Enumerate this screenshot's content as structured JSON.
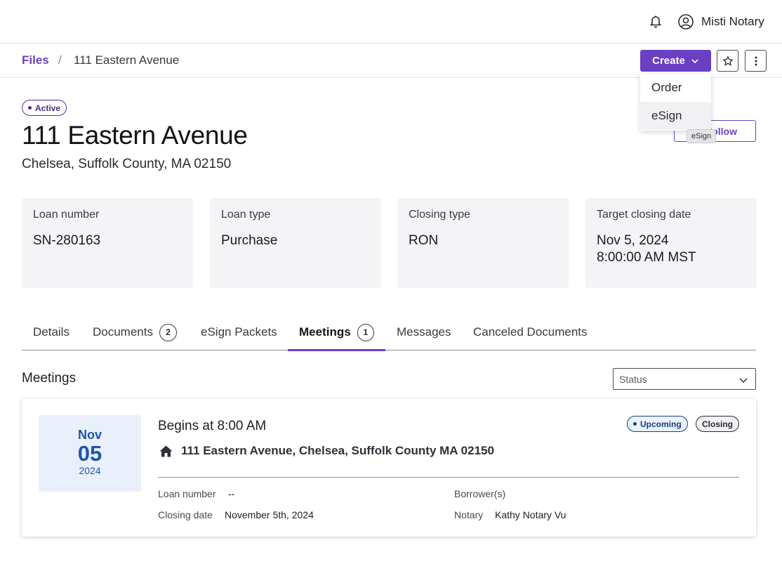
{
  "topbar": {
    "user_name": "Misti Notary"
  },
  "breadcrumb": {
    "root": "Files",
    "separator": "/",
    "current": "111 Eastern Avenue"
  },
  "actions": {
    "create_label": "Create",
    "dropdown_items": [
      "Order",
      "eSign"
    ],
    "tooltip": "eSign",
    "follow_label": "Follow"
  },
  "header": {
    "status": "Active",
    "title": "111 Eastern Avenue",
    "subtitle": "Chelsea, Suffolk County, MA 02150"
  },
  "cards": [
    {
      "label": "Loan number",
      "value": "SN-280163"
    },
    {
      "label": "Loan type",
      "value": "Purchase"
    },
    {
      "label": "Closing type",
      "value": "RON"
    },
    {
      "label": "Target closing date",
      "value": "Nov 5, 2024",
      "value2": "8:00:00 AM MST"
    }
  ],
  "tabs": [
    {
      "label": "Details"
    },
    {
      "label": "Documents",
      "badge": "2"
    },
    {
      "label": "eSign Packets"
    },
    {
      "label": "Meetings",
      "badge": "1",
      "active": true
    },
    {
      "label": "Messages"
    },
    {
      "label": "Canceled Documents"
    }
  ],
  "meetings": {
    "section_title": "Meetings",
    "filter_placeholder": "Status",
    "items": [
      {
        "month": "Nov",
        "day": "05",
        "year": "2024",
        "time": "Begins at 8:00 AM",
        "status_chip": "Upcoming",
        "type_chip": "Closing",
        "address": "111 Eastern Avenue, Chelsea, Suffolk County MA 02150",
        "loan_number_label": "Loan number",
        "loan_number": "--",
        "closing_date_label": "Closing date",
        "closing_date": "November 5th, 2024",
        "borrowers_label": "Borrower(s)",
        "notary_label": "Notary",
        "notary": "Kathy Notary Vu"
      }
    ]
  },
  "colors": {
    "accent": "#6a3fc4",
    "date_box": "#e9f0fb",
    "date_text": "#1f55a8"
  }
}
